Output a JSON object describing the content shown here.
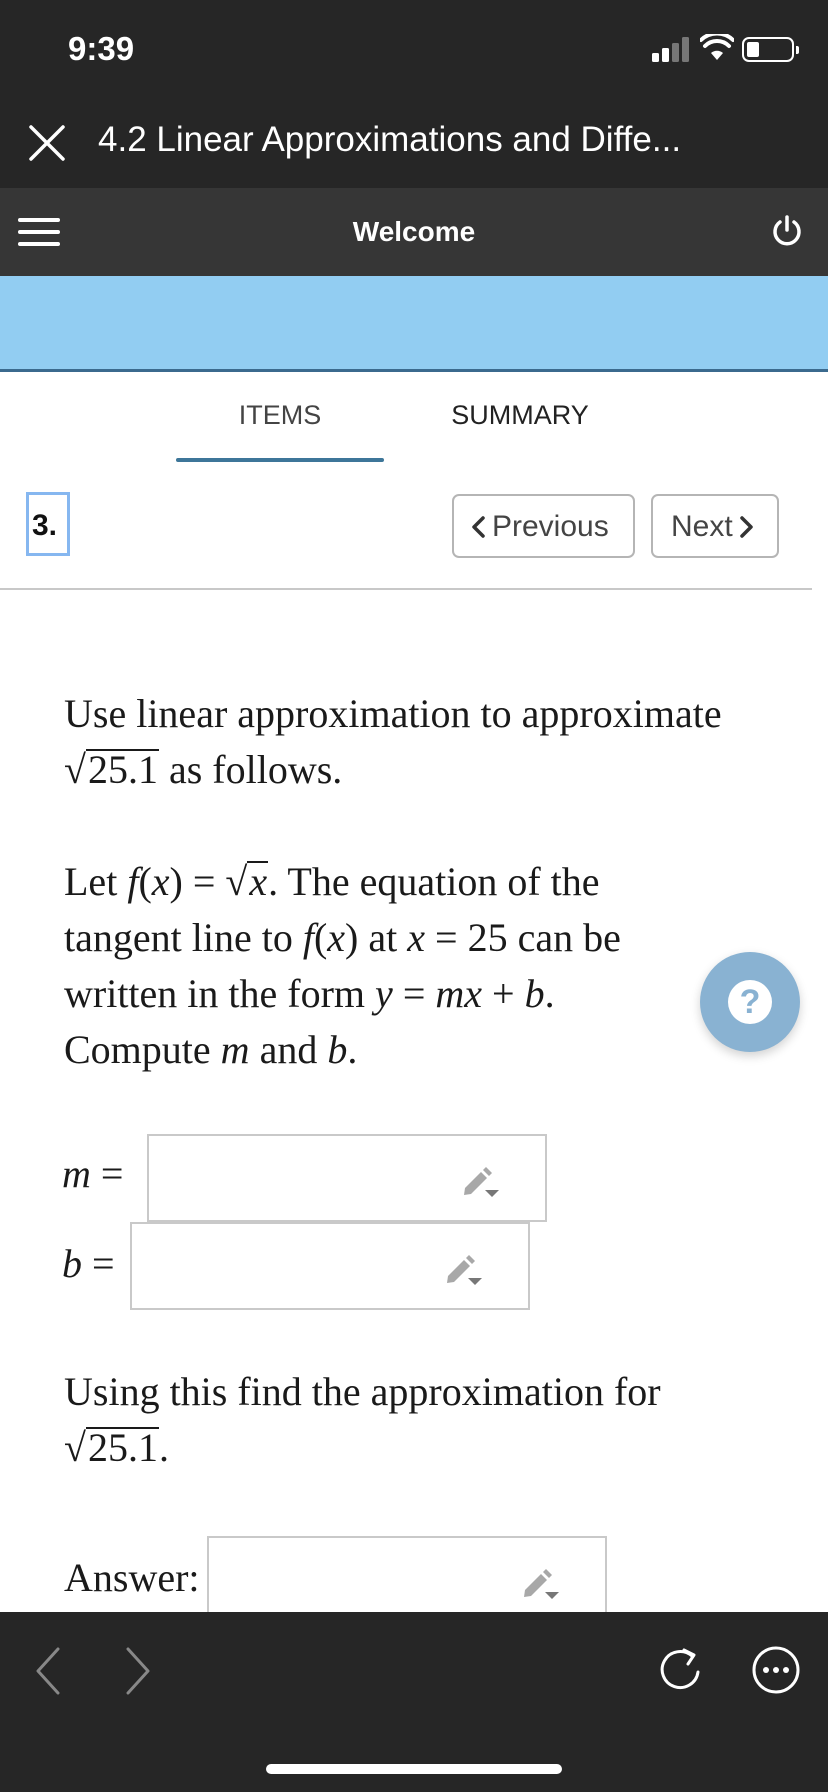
{
  "status_bar": {
    "time": "9:39"
  },
  "title_bar": {
    "title": "4.2 Linear Approximations and Diffe..."
  },
  "nav_bar": {
    "title": "Welcome"
  },
  "tabs": [
    {
      "label": "ITEMS",
      "active": true
    },
    {
      "label": "SUMMARY",
      "active": false
    }
  ],
  "question": {
    "number": "3.",
    "prev_label": "Previous",
    "next_label": "Next",
    "intro_text": "Use linear approximation to approximate",
    "radicand": "25.1",
    "intro_suffix": "as follows.",
    "body": {
      "let": "Let",
      "f": "f",
      "x": "x",
      "eq": "=",
      "sentence_a": ". The equation of the tangent line to",
      "at": "at",
      "x_value": "25",
      "sentence_b": "can be written in the form",
      "y": "y",
      "m": "m",
      "plus": "+",
      "b": "b",
      "compute": "Compute",
      "and": "and"
    },
    "fields": {
      "m_label": "m",
      "b_label": "b",
      "m_value": "",
      "b_value": ""
    },
    "follow_text": "Using this find the approximation for",
    "follow_radicand": "25.1",
    "answer_label": "Answer:",
    "answer_value": ""
  },
  "colors": {
    "dark_bar": "#262626",
    "nav_bar": "#363636",
    "banner": "#92cdf2",
    "accent": "#3d7699",
    "help_fab": "#89b2d2"
  },
  "icons": [
    "close-icon",
    "menu-icon",
    "power-icon",
    "pencil-dropdown-icon",
    "help-icon",
    "back-arrow-icon",
    "forward-arrow-icon",
    "refresh-icon",
    "more-icon"
  ]
}
